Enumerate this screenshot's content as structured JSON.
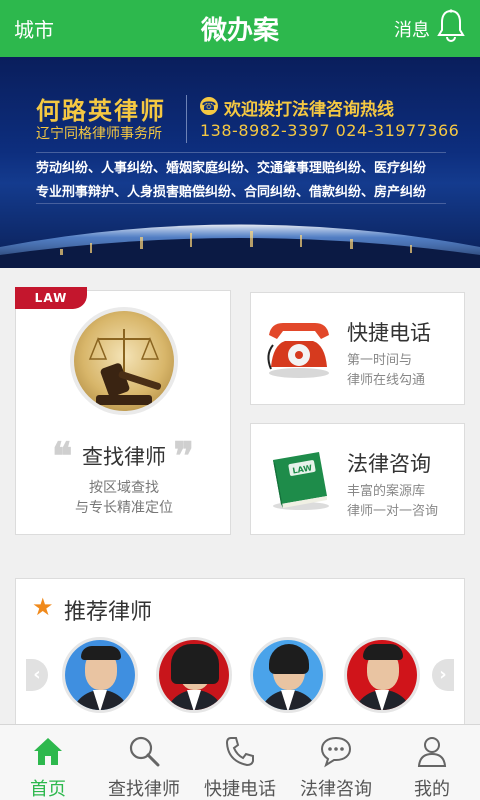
{
  "header": {
    "city": "城市",
    "title": "微办案",
    "messages": "消息"
  },
  "banner": {
    "firm_name": "何路英律师",
    "firm_sub": "辽宁同格律师事务所",
    "hotline_title": "欢迎拨打法律咨询热线",
    "hotline_numbers": "138-8982-3397  024-31977366",
    "cases_line1": "劳动纠纷、人事纠纷、婚姻家庭纠纷、交通肇事理赔纠纷、医疗纠纷",
    "cases_line2": "专业刑事辩护、人身损害赔偿纠纷、合同纠纷、借款纠纷、房产纠纷"
  },
  "cards": {
    "find": {
      "ribbon": "LAW",
      "title": "查找律师",
      "sub1": "按区域查找",
      "sub2": "与专长精准定位"
    },
    "phone": {
      "title": "快捷电话",
      "sub1": "第一时间与",
      "sub2": "律师在线勾通"
    },
    "consult": {
      "title": "法律咨询",
      "sub1": "丰富的案源库",
      "sub2": "律师一对一咨询",
      "book_label": "LAW"
    }
  },
  "recommended": {
    "title": "推荐律师"
  },
  "tabs": [
    {
      "label": "首页",
      "icon": "home-icon",
      "active": true
    },
    {
      "label": "查找律师",
      "icon": "search-icon",
      "active": false
    },
    {
      "label": "快捷电话",
      "icon": "phone-icon",
      "active": false
    },
    {
      "label": "法律咨询",
      "icon": "chat-icon",
      "active": false
    },
    {
      "label": "我的",
      "icon": "user-icon",
      "active": false
    }
  ],
  "colors": {
    "brand_green": "#2db84d",
    "banner_gold": "#f5c842",
    "ribbon_red": "#c4162d",
    "star_orange": "#f08a1c"
  }
}
